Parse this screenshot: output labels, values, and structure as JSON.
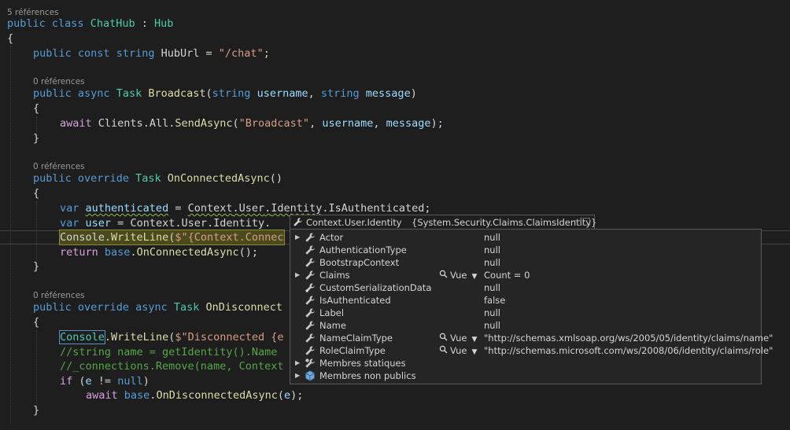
{
  "code": {
    "lens": {
      "class_refs": "5 références",
      "broadcast_refs": "0 références",
      "connected_refs": "0 références",
      "disconnected_refs": "0 références"
    },
    "lines": {
      "l1": [
        "public",
        " ",
        "class",
        " ",
        "ChatHub",
        " : ",
        "Hub"
      ],
      "l2": "{",
      "l3": [
        "public",
        " ",
        "const",
        " ",
        "string",
        " ",
        "HubUrl",
        " = ",
        "\"/chat\"",
        ";"
      ],
      "l4": [
        "public",
        " ",
        "async",
        " ",
        "Task",
        " ",
        "Broadcast",
        "(",
        "string",
        " ",
        "username",
        ", ",
        "string",
        " ",
        "message",
        ")"
      ],
      "l5": "{",
      "l6": [
        "await",
        " ",
        "Clients",
        ".",
        "All",
        ".",
        "SendAsync",
        "(",
        "\"Broadcast\"",
        ", ",
        "username",
        ", ",
        "message",
        ");"
      ],
      "l7": "}",
      "l8": [
        "public",
        " ",
        "override",
        " ",
        "Task",
        " ",
        "OnConnectedAsync",
        "()"
      ],
      "l9": "{",
      "l10": [
        "var",
        " ",
        "authenticated",
        " = ",
        "Context",
        ".",
        "User",
        ".",
        "Identity",
        ".",
        "IsAuthenticated",
        ";"
      ],
      "l11": [
        "var",
        " ",
        "user",
        " = ",
        "Context",
        ".",
        "User",
        ".",
        "Identity",
        "."
      ],
      "l12": [
        "Console",
        ".",
        "WriteLine",
        "(",
        "$\"{Context.Connec"
      ],
      "l13": [
        "return",
        " ",
        "base",
        ".",
        "OnConnectedAsync",
        "();"
      ],
      "l14": "}",
      "l15": [
        "public",
        " ",
        "override",
        " ",
        "async",
        " ",
        "Task",
        " ",
        "OnDisconnect"
      ],
      "l16": "{",
      "l17": [
        "Console",
        ".",
        "WriteLine",
        "(",
        "$\"Disconnected {e"
      ],
      "l18": "//string name = getIdentity().Name",
      "l19": "//_connections.Remove(name, Context",
      "l20": [
        "if",
        " (",
        "e",
        " != ",
        "null",
        ")"
      ],
      "l21": [
        "await",
        " ",
        "base",
        ".",
        "OnDisconnectedAsync",
        "(",
        "e",
        ");"
      ],
      "l22": "}"
    }
  },
  "datatip": {
    "header_name": "Context.User.Identity",
    "header_value": "{System.Security.Claims.ClaimsIdentity}",
    "rows": [
      {
        "name": "Actor",
        "value": "null",
        "expandable": true,
        "icon": "wrench-icon",
        "viewer": false
      },
      {
        "name": "AuthenticationType",
        "value": "null",
        "expandable": false,
        "icon": "wrench-icon",
        "viewer": false
      },
      {
        "name": "BootstrapContext",
        "value": "null",
        "expandable": false,
        "icon": "wrench-icon",
        "viewer": false
      },
      {
        "name": "Claims",
        "value": "Count = 0",
        "expandable": true,
        "icon": "wrench-icon",
        "viewer": true
      },
      {
        "name": "CustomSerializationData",
        "value": "null",
        "expandable": false,
        "icon": "wrench-star-icon",
        "viewer": false
      },
      {
        "name": "IsAuthenticated",
        "value": "false",
        "expandable": false,
        "icon": "wrench-icon",
        "viewer": false
      },
      {
        "name": "Label",
        "value": "null",
        "expandable": false,
        "icon": "wrench-icon",
        "viewer": false
      },
      {
        "name": "Name",
        "value": "null",
        "expandable": false,
        "icon": "wrench-icon",
        "viewer": false
      },
      {
        "name": "NameClaimType",
        "value": "\"http://schemas.xmlsoap.org/ws/2005/05/identity/claims/name\"",
        "expandable": false,
        "icon": "wrench-icon",
        "viewer": true
      },
      {
        "name": "RoleClaimType",
        "value": "\"http://schemas.microsoft.com/ws/2008/06/identity/claims/role\"",
        "expandable": false,
        "icon": "wrench-icon",
        "viewer": true
      },
      {
        "name": "Membres statiques",
        "value": "",
        "expandable": true,
        "icon": "static-members-icon",
        "viewer": false
      },
      {
        "name": "Membres non publics",
        "value": "",
        "expandable": true,
        "icon": "non-public-members-icon",
        "viewer": false
      }
    ],
    "viewer_label": "Vue"
  }
}
